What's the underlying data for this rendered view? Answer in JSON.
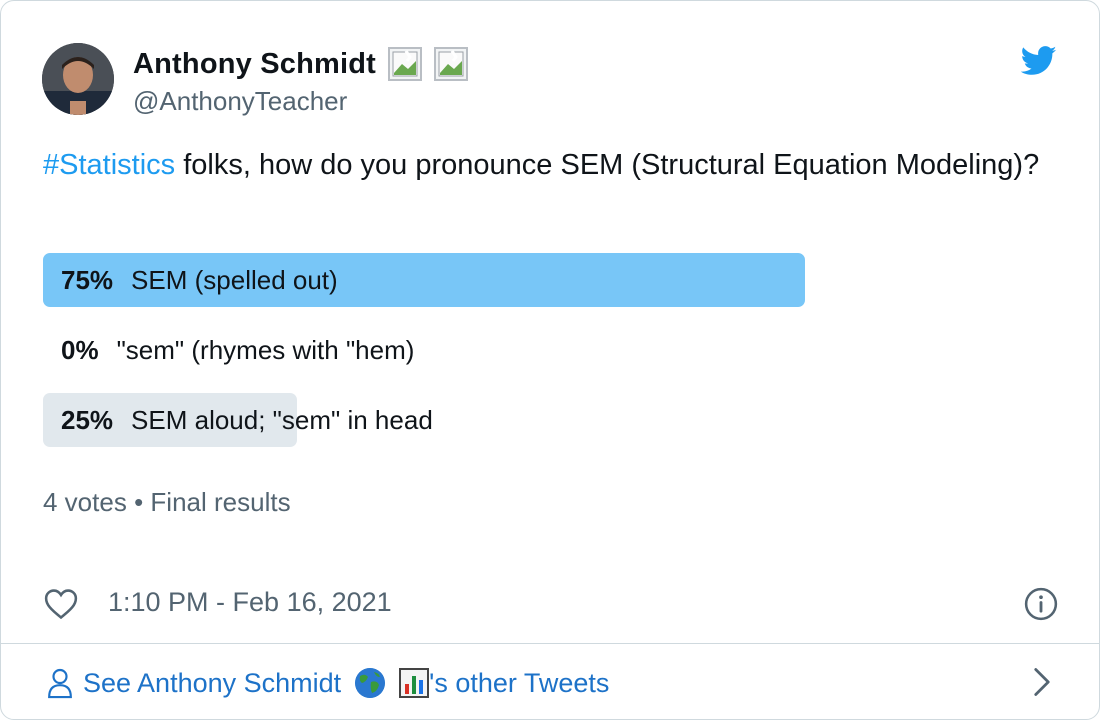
{
  "user": {
    "name": "Anthony Schmidt",
    "handle": "@AnthonyTeacher",
    "badge_icons": [
      "broken-image-icon",
      "broken-image-icon"
    ]
  },
  "tweet": {
    "hashtag": "#Statistics",
    "text": " folks, how do you pronounce SEM (Structural Equation Modeling)?"
  },
  "poll": {
    "options": [
      {
        "percent": "75%",
        "label": "SEM (spelled out)",
        "share": 0.75,
        "winner": true
      },
      {
        "percent": "0%",
        "label": "\"sem\" (rhymes with \"hem)",
        "share": 0.0,
        "winner": false
      },
      {
        "percent": "25%",
        "label": "SEM aloud; \"sem\" in head",
        "share": 0.25,
        "winner": false
      }
    ],
    "votes": "4 votes",
    "separator": "•",
    "status": "Final results"
  },
  "meta": {
    "timestamp": "1:10 PM - Feb 16, 2021"
  },
  "footer": {
    "see_prefix": "See Anthony Schmidt",
    "see_suffix": "'s other Tweets"
  },
  "colors": {
    "accent": "#1d9bf0",
    "winner_bar": "#78c6f7",
    "other_bar": "#e1e8ed",
    "secondary_text": "#536471",
    "link": "#1d72c8"
  }
}
